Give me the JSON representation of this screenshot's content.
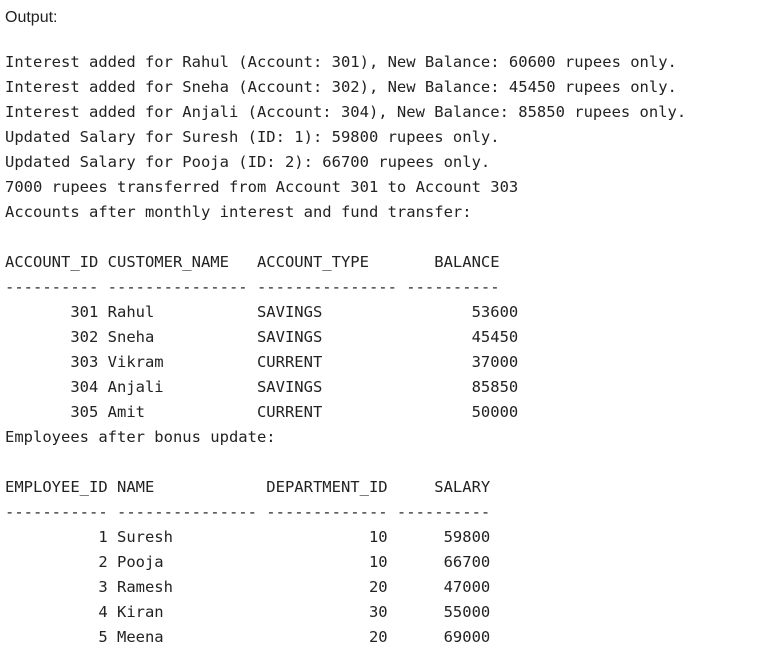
{
  "output_heading": "Output:",
  "messages": {
    "interest": [
      "Interest added for Rahul (Account: 301), New Balance: 60600 rupees only.",
      "Interest added for Sneha (Account: 302), New Balance: 45450 rupees only.",
      "Interest added for Anjali (Account: 304), New Balance: 85850 rupees only."
    ],
    "salary": [
      "Updated Salary for Suresh (ID: 1): 59800 rupees only.",
      "Updated Salary for Pooja (ID: 2): 66700 rupees only."
    ],
    "transfer": "7000 rupees transferred from Account 301 to Account 303",
    "accounts_caption": "Accounts after monthly interest and fund transfer:",
    "employees_caption": "Employees after bonus update:"
  },
  "accounts_table": {
    "header": "ACCOUNT_ID CUSTOMER_NAME   ACCOUNT_TYPE       BALANCE",
    "separator": "---------- --------------- --------------- ----------",
    "rows": [
      "       301 Rahul           SAVINGS                53600",
      "       302 Sneha           SAVINGS                45450",
      "       303 Vikram          CURRENT                37000",
      "       304 Anjali          SAVINGS                85850",
      "       305 Amit            CURRENT                50000"
    ]
  },
  "employees_table": {
    "header": "EMPLOYEE_ID NAME            DEPARTMENT_ID     SALARY",
    "separator": "----------- --------------- ------------- ----------",
    "rows": [
      "          1 Suresh                     10      59800",
      "          2 Pooja                      10      66700",
      "          3 Ramesh                     20      47000",
      "          4 Kiran                      30      55000",
      "          5 Meena                      20      69000"
    ]
  }
}
